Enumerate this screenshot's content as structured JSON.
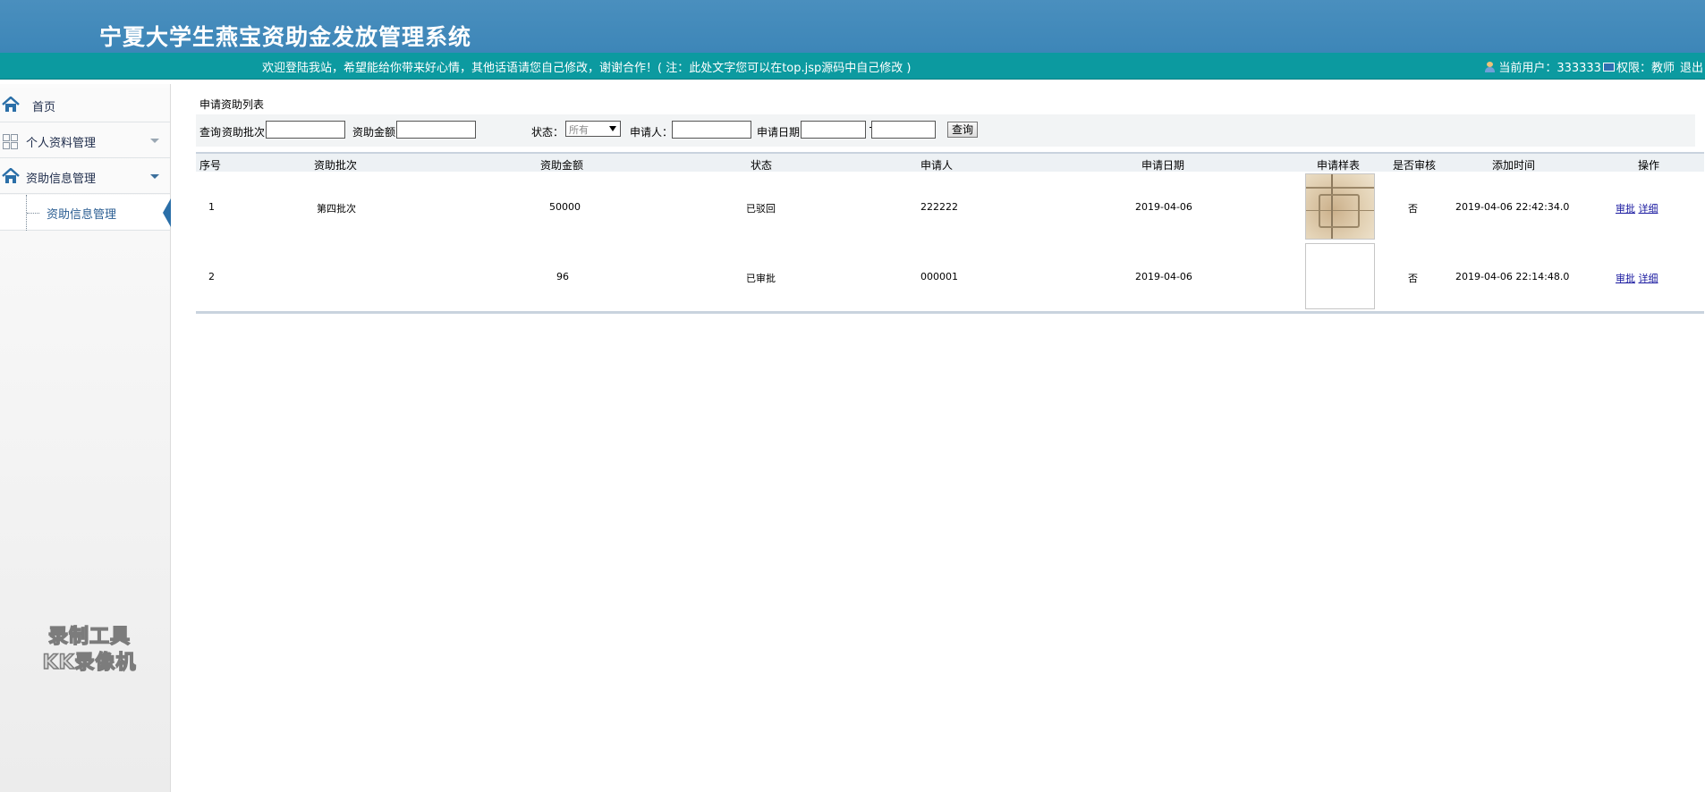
{
  "header": {
    "title": "宁夏大学生燕宝资助金发放管理系统",
    "welcome": "欢迎登陆我站，希望能给你带来好心情，其他话语请您自己修改，谢谢合作！( 注：此处文字您可以在top.jsp源码中自己修改 )",
    "current_user_label": "当前用户：333333",
    "role_label": "权限：教师",
    "logout_label": "退出"
  },
  "sidebar": {
    "items": [
      {
        "label": "首页"
      },
      {
        "label": "个人资料管理"
      },
      {
        "label": "资助信息管理"
      }
    ],
    "sub_items": [
      {
        "label": "资助信息管理"
      }
    ]
  },
  "watermark": {
    "line1": "录制工具",
    "line2": "KK录像机"
  },
  "main": {
    "section_title": "申请资助列表",
    "search": {
      "prefix": "查询",
      "batch_label": "资助批次：",
      "batch_value": "",
      "amount_label": "资助金额：",
      "amount_value": "",
      "status_label": "状态：",
      "status_selected": "所有",
      "applicant_label": "申请人：",
      "applicant_value": "",
      "date_label": "申请日期：",
      "date_from": "",
      "date_to": "",
      "button": "查询"
    },
    "table": {
      "columns": [
        "序号",
        "资助批次",
        "资助金额",
        "状态",
        "申请人",
        "申请日期",
        "申请样表",
        "是否审核",
        "添加时间",
        "操作"
      ],
      "rows": [
        {
          "no": "1",
          "batch": "第四批次",
          "amount": "50000",
          "status": "已驳回",
          "applicant": "222222",
          "date": "2019-04-06",
          "reviewed": "否",
          "added": "2019-04-06 22:42:34.0",
          "action_approve": "审批",
          "action_detail": "详细"
        },
        {
          "no": "2",
          "batch": "",
          "amount": "96",
          "status": "已审批",
          "applicant": "000001",
          "date": "2019-04-06",
          "reviewed": "否",
          "added": "2019-04-06 22:14:48.0",
          "action_approve": "审批",
          "action_detail": "详细"
        }
      ]
    }
  }
}
